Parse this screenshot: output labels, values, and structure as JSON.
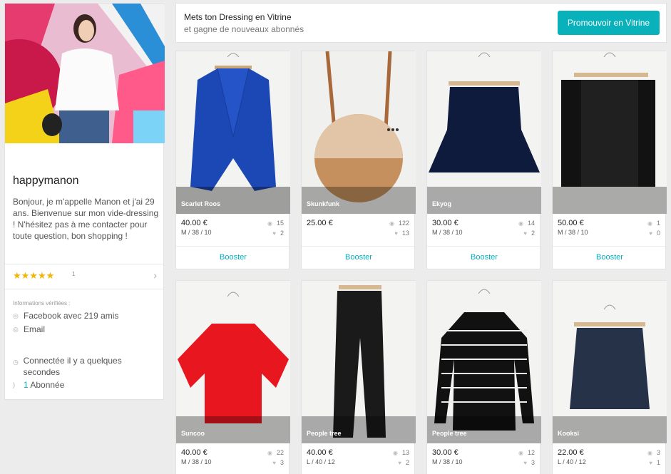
{
  "profile": {
    "username": "happymanon",
    "bio": "Bonjour, je m'appelle Manon et j'ai 29 ans. Bienvenue sur mon vide-dressing ! N'hésitez pas à me contacter pour toute question, bon shopping !",
    "stars": "★★★★★",
    "rating_count": "1",
    "verified_label": "Informations vérifiées :",
    "facebook": "Facebook avec 219 amis",
    "email": "Email",
    "last_seen": "Connectée il y a quelques secondes",
    "followers_count": "1",
    "followers_label": " Abonnée"
  },
  "banner": {
    "title": "Mets ton Dressing en Vitrine",
    "subtitle": "et gagne de nouveaux abonnés",
    "button": "Promouvoir en Vitrine"
  },
  "items": [
    {
      "brand": "Scarlet Roos",
      "price": "40.00 €",
      "size": "M / 38 / 10",
      "views": "15",
      "likes": "2",
      "booster": "Booster"
    },
    {
      "brand": "Skunkfunk",
      "price": "25.00 €",
      "size": "",
      "views": "122",
      "likes": "13",
      "booster": "Booster"
    },
    {
      "brand": "Ekyog",
      "price": "30.00 €",
      "size": "M / 38 / 10",
      "views": "14",
      "likes": "2",
      "booster": "Booster"
    },
    {
      "brand": "",
      "price": "50.00 €",
      "size": "M / 38 / 10",
      "views": "1",
      "likes": "0",
      "booster": "Booster"
    },
    {
      "brand": "Suncoo",
      "price": "40.00 €",
      "size": "M / 38 / 10",
      "views": "22",
      "likes": "3",
      "booster": ""
    },
    {
      "brand": "People tree",
      "price": "40.00 €",
      "size": "L / 40 / 12",
      "views": "13",
      "likes": "2",
      "booster": ""
    },
    {
      "brand": "People tree",
      "price": "30.00 €",
      "size": "M / 38 / 10",
      "views": "12",
      "likes": "3",
      "booster": ""
    },
    {
      "brand": "Kooksi",
      "price": "22.00 €",
      "size": "L / 40 / 12",
      "views": "3",
      "likes": "1",
      "booster": ""
    }
  ],
  "colors": {
    "accent": "#09b1ba",
    "stars": "#f5b400"
  },
  "icons": {
    "views": "eye-icon",
    "likes": "heart-icon",
    "verified": "check-circle-icon",
    "clock": "clock-icon",
    "rss": "rss-icon"
  }
}
